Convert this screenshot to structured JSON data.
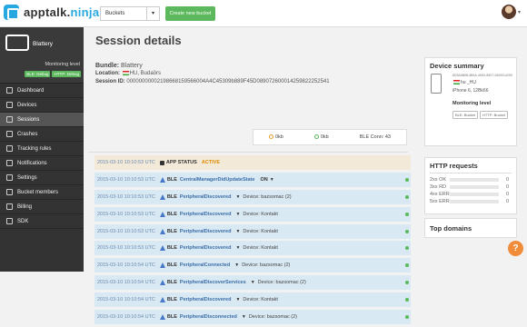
{
  "header": {
    "logo_main": "apptalk.",
    "logo_accent": "ninja",
    "bucket_select": "Buckets",
    "create_bucket": "Create new bucket"
  },
  "sidebar": {
    "device_name": "Blattery",
    "monitoring_label": "Monitoring level",
    "tags": [
      "BLE: Debug",
      "HTTP: Debug"
    ],
    "items": [
      {
        "label": "Dashboard",
        "icon": "dashboard-icon"
      },
      {
        "label": "Devices",
        "icon": "devices-icon"
      },
      {
        "label": "Sessions",
        "icon": "sessions-icon"
      },
      {
        "label": "Crashes",
        "icon": "crashes-icon"
      },
      {
        "label": "Tracking rules",
        "icon": "tracking-icon"
      },
      {
        "label": "Notifications",
        "icon": "notifications-icon"
      },
      {
        "label": "Settings",
        "icon": "settings-icon"
      },
      {
        "label": "Bucket members",
        "icon": "members-icon"
      },
      {
        "label": "Billing",
        "icon": "billing-icon"
      },
      {
        "label": "SDK",
        "icon": "sdk-icon"
      }
    ],
    "active_index": 2
  },
  "main": {
    "title": "Session details",
    "bundle_label": "Bundle:",
    "bundle_value": "Blattery",
    "location_label": "Location:",
    "location_value": "HU, Budaörs",
    "session_label": "Session ID:",
    "session_value": "00000000002198668159566004A4C45309b889F45D089072600014259822252541",
    "stats": [
      {
        "value": "0kb",
        "color": "#e8a030"
      },
      {
        "value": "0kb",
        "color": "#5cb85c"
      },
      {
        "value": "BLE Conn: 43",
        "color": ""
      }
    ]
  },
  "log": [
    {
      "ts": "2015-03-10 10:10:53 UTC",
      "kind": "app",
      "cat": "APP STATUS",
      "ev": "",
      "status": "ACTIVE",
      "extra": ""
    },
    {
      "ts": "2015-03-10 10:10:53 UTC",
      "kind": "ble",
      "cat": "BLE",
      "ev": "CentralManagerDidUpdateState",
      "status": "ON",
      "extra": ""
    },
    {
      "ts": "2015-03-10 10:10:53 UTC",
      "kind": "ble",
      "cat": "BLE",
      "ev": "PeripheralDiscovered",
      "status": "",
      "extra": "Device: bazsomac (2)"
    },
    {
      "ts": "2015-03-10 10:10:53 UTC",
      "kind": "ble",
      "cat": "BLE",
      "ev": "PeripheralDiscovered",
      "status": "",
      "extra": "Device: Kontakt"
    },
    {
      "ts": "2015-03-10 10:10:53 UTC",
      "kind": "ble",
      "cat": "BLE",
      "ev": "PeripheralDiscovered",
      "status": "",
      "extra": "Device: Kontakt"
    },
    {
      "ts": "2015-03-10 10:10:53 UTC",
      "kind": "ble",
      "cat": "BLE",
      "ev": "PeripheralDiscovered",
      "status": "",
      "extra": "Device: Kontakt"
    },
    {
      "ts": "2015-03-10 10:10:54 UTC",
      "kind": "ble",
      "cat": "BLE",
      "ev": "PeripheralConnected",
      "status": "",
      "extra": "Device: bazsomac (2)"
    },
    {
      "ts": "2015-03-10 10:10:54 UTC",
      "kind": "ble",
      "cat": "BLE",
      "ev": "PeripheralDiscoverServices",
      "status": "",
      "extra": "Device: bazsomac (2)"
    },
    {
      "ts": "2015-03-10 10:10:54 UTC",
      "kind": "ble",
      "cat": "BLE",
      "ev": "PeripheralDiscovered",
      "status": "",
      "extra": "Device: Kontakt"
    },
    {
      "ts": "2015-03-10 10:10:54 UTC",
      "kind": "ble",
      "cat": "BLE",
      "ev": "PeripheralDisconnected",
      "status": "",
      "extra": "Device: bazsomac (2)"
    }
  ],
  "device_summary": {
    "title": "Device summary",
    "id": "8D3A6B0B-889A-45D0-8907-2600014259",
    "location": "hu _HU",
    "model": "iPhone 6, 12Bk66",
    "monitoring": "Monitoring level",
    "tags": [
      "BLE: Bucket",
      "HTTP: Bucket"
    ]
  },
  "http": {
    "title": "HTTP requests",
    "rows": [
      {
        "label": "2xx OK",
        "value": "0"
      },
      {
        "label": "3xx RD",
        "value": "0"
      },
      {
        "label": "4xx ERR",
        "value": "0"
      },
      {
        "label": "5xx ERR",
        "value": "0"
      }
    ]
  },
  "top_domains": {
    "title": "Top domains"
  },
  "help": "?"
}
